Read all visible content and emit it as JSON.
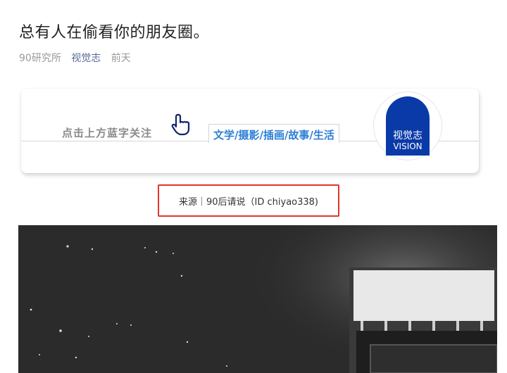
{
  "article": {
    "title": "总有人在偷看你的朋友圈。",
    "author": "90研究所",
    "account": "视觉志",
    "time": "前天"
  },
  "banner": {
    "hint": "点击上方蓝字关注",
    "tags": "文学/摄影/插画/故事/生活",
    "logo_cn": "视觉志",
    "logo_en": "VISION"
  },
  "source": {
    "text": "来源｜90后请说（ID chiyao338)"
  },
  "colors": {
    "accent_link": "#576b95",
    "tag_blue": "#2c7fd6",
    "logo_blue": "#0a3aa8",
    "source_border": "#e0362b"
  },
  "icons": {
    "hand": "pointing-hand-icon"
  }
}
